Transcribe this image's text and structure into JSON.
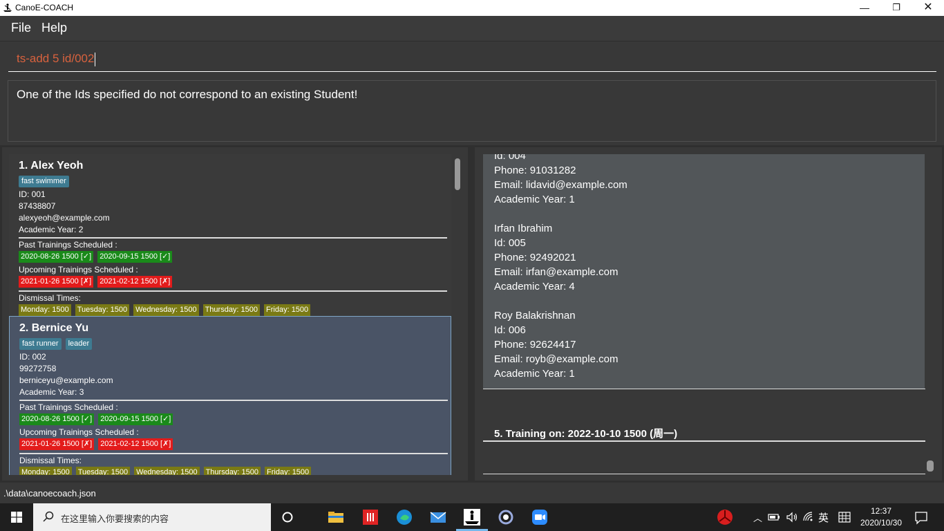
{
  "window": {
    "title": "CanoE-COACH",
    "minimize_glyph": "—",
    "maximize_glyph": "❐",
    "close_glyph": "✕"
  },
  "menu": {
    "file": "File",
    "help": "Help"
  },
  "command": {
    "value": "ts-add 5 id/002"
  },
  "result": {
    "message": "One of the Ids specified do not correspond to an existing Student!"
  },
  "students": [
    {
      "name": "1.  Alex Yeoh",
      "tags": [
        "fast swimmer"
      ],
      "id": "ID: 001",
      "phone": "87438807",
      "email": "alexyeoh@example.com",
      "year": "Academic Year: 2",
      "past_label": "Past Trainings Scheduled :",
      "past": [
        "2020-08-26 1500 [✓]",
        "2020-09-15 1500 [✓]"
      ],
      "upcoming_label": "Upcoming Trainings Scheduled :",
      "upcoming": [
        "2021-01-26 1500 [✗]",
        "2021-02-12 1500 [✗]"
      ],
      "dismissal_label": "Dismissal Times:",
      "dismissal": [
        "Monday: 1500",
        "Tuesday: 1500",
        "Wednesday: 1500",
        "Thursday: 1500",
        "Friday: 1500"
      ]
    },
    {
      "name": "2.  Bernice Yu",
      "tags": [
        "fast runner",
        "leader"
      ],
      "id": "ID: 002",
      "phone": "99272758",
      "email": "berniceyu@example.com",
      "year": "Academic Year: 3",
      "past_label": "Past Trainings Scheduled :",
      "past": [
        "2020-08-26 1500 [✓]",
        "2020-09-15 1500 [✓]"
      ],
      "upcoming_label": "Upcoming Trainings Scheduled :",
      "upcoming": [
        "2021-01-26 1500 [✗]",
        "2021-02-12 1500 [✗]"
      ],
      "dismissal_label": "Dismissal Times:",
      "dismissal": [
        "Monday: 1500",
        "Tuesday: 1500",
        "Wednesday: 1500",
        "Thursday: 1500",
        "Friday: 1500"
      ]
    }
  ],
  "training_detail": {
    "partial_id": "Id: 004",
    "partial_phone": "Phone: 91031282",
    "partial_email": "Email: lidavid@example.com",
    "partial_year": "Academic  Year: 1",
    "attendees": [
      {
        "name": "Irfan Ibrahim",
        "id": "Id: 005",
        "phone": "Phone: 92492021",
        "email": "Email: irfan@example.com",
        "year": "Academic  Year: 4"
      },
      {
        "name": "Roy Balakrishnan",
        "id": "Id: 006",
        "phone": "Phone: 92624417",
        "email": "Email: royb@example.com",
        "year": "Academic  Year: 1"
      }
    ],
    "next_training": "5.  Training on: 2022-10-10 1500 (周一)"
  },
  "status": {
    "path": ".\\data\\canoecoach.json"
  },
  "taskbar": {
    "search_placeholder": "在这里输入你要搜索的内容",
    "ime": "英",
    "time": "12:37",
    "date": "2020/10/30"
  }
}
